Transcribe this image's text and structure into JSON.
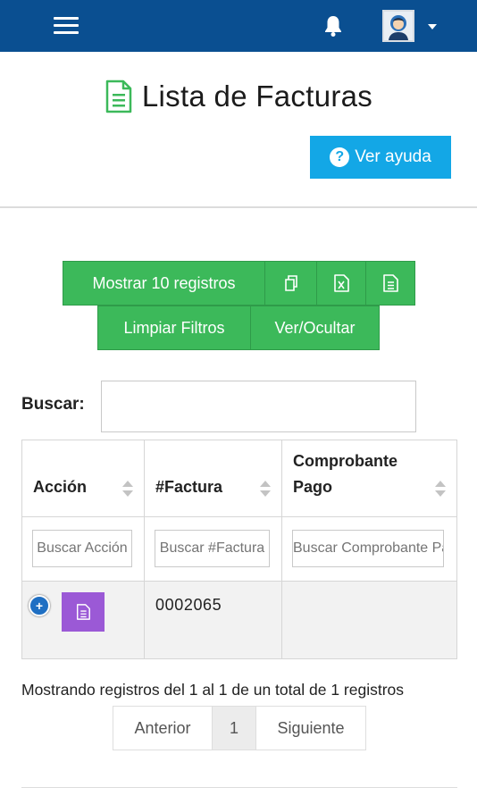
{
  "header": {
    "menu_icon": "hamburger-icon",
    "bell_icon": "bell-icon",
    "avatar_icon": "user-avatar",
    "dropdown_icon": "caret-down-icon",
    "color": "#0a4f91"
  },
  "page": {
    "title": "Lista de Facturas",
    "title_icon": "document-icon",
    "title_icon_color": "#3cb95a",
    "help_button": "Ver ayuda",
    "help_color": "#13a7e6"
  },
  "toolbar": {
    "show_records": "Mostrar 10 registros",
    "copy_icon": "copy-icon",
    "excel_icon": "excel-icon",
    "csv_icon": "file-icon",
    "clear_filters": "Limpiar Filtros",
    "toggle_columns": "Ver/Ocultar",
    "color": "#3cb95a"
  },
  "search": {
    "label": "Buscar:",
    "value": ""
  },
  "table": {
    "columns": [
      "Acción",
      "#Factura",
      "Comprobante\nPago"
    ],
    "filters": [
      "Buscar Acción",
      "Buscar #Factura",
      "Buscar Comprobante Pago"
    ],
    "rows": [
      {
        "factura": "0002065",
        "comprobante": "",
        "action_color": "#9b59d6"
      }
    ]
  },
  "pagination": {
    "info": "Mostrando registros del 1 al 1 de un total de 1 registros",
    "previous": "Anterior",
    "current": "1",
    "next": "Siguiente"
  }
}
